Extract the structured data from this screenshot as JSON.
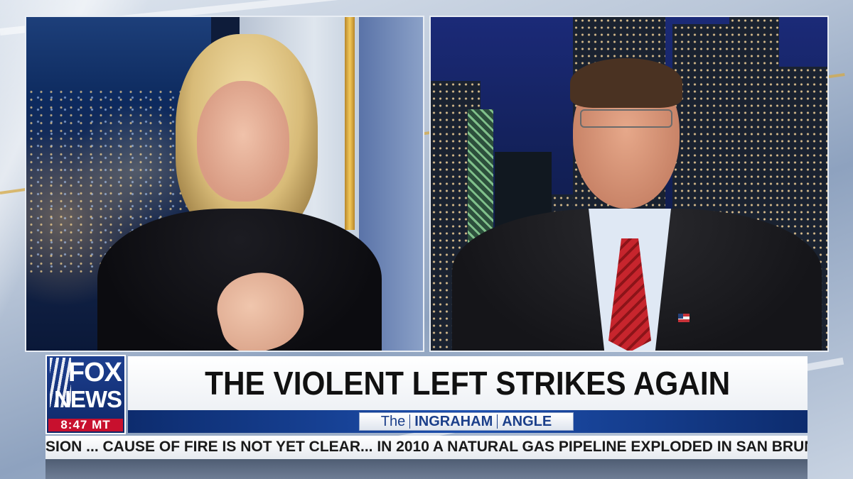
{
  "network": {
    "logo_line1": "FOX",
    "logo_line2": "NEWS",
    "time": "8:47 MT"
  },
  "lower_third": {
    "headline": "THE VIOLENT LEFT STRIKES AGAIN",
    "show_name_prefix": "The",
    "show_name_word1": "INGRAHAM",
    "show_name_word2": "ANGLE"
  },
  "ticker": {
    "text": "SION ...   CAUSE OF FIRE IS NOT YET CLEAR...   IN 2010 A NATURAL GAS PIPELINE EXPLODED IN SAN BRUN"
  },
  "colors": {
    "brand_blue": "#0e2868",
    "time_red": "#c8102e",
    "tie_red": "#c7252d"
  }
}
